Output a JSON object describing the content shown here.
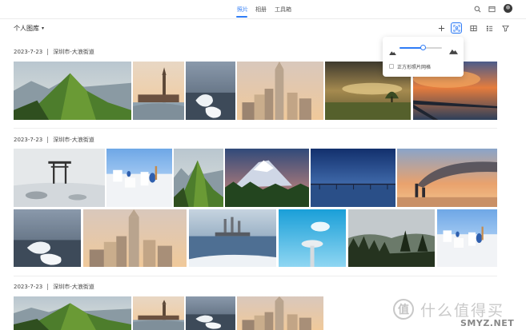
{
  "nav": {
    "tabs": [
      {
        "label": "照片",
        "active": true
      },
      {
        "label": "相册",
        "active": false
      },
      {
        "label": "工具箱",
        "active": false
      }
    ],
    "icons": [
      "search-icon",
      "window-icon",
      "user-avatar"
    ],
    "accent_color": "#2f7cf6"
  },
  "toolbar": {
    "library_label": "个人图库",
    "buttons": [
      "add-icon",
      "face-scan-icon",
      "grid-icon",
      "list-icon",
      "filter-icon"
    ]
  },
  "popover": {
    "zoom_level": 0.55,
    "checkbox_label": "正方形照片网格",
    "checkbox_checked": false
  },
  "sections": [
    {
      "date": "2023-7-23",
      "location": "深圳市-大浪街道"
    },
    {
      "date": "2023-7-23",
      "location": "深圳市-大浪街道"
    },
    {
      "date": "2023-7-23",
      "location": "深圳市-大浪街道"
    }
  ],
  "photos": [
    "green-mountain-ridge",
    "big-ben-london",
    "frozen-rocks-sea",
    "city-skyscraper-sunset",
    "foggy-field-sunrise",
    "pier-sunset-clouds",
    "torii-gate-snow",
    "white-blue-village",
    "green-mountain-ridge",
    "snow-volcano-forest",
    "pier-blue-dusk",
    "factory-smoke-sunset",
    "frozen-rocks-sea",
    "city-skyscraper-sunset",
    "power-plant-lake",
    "ufo-tower-sky",
    "misty-forest-valley",
    "white-blue-village",
    "green-mountain-ridge",
    "big-ben-london",
    "frozen-rocks-sea",
    "city-skyscraper-sunset"
  ],
  "watermark": {
    "logo_char": "值",
    "text": "什么值得买",
    "sub": "SMYZ.NET"
  }
}
